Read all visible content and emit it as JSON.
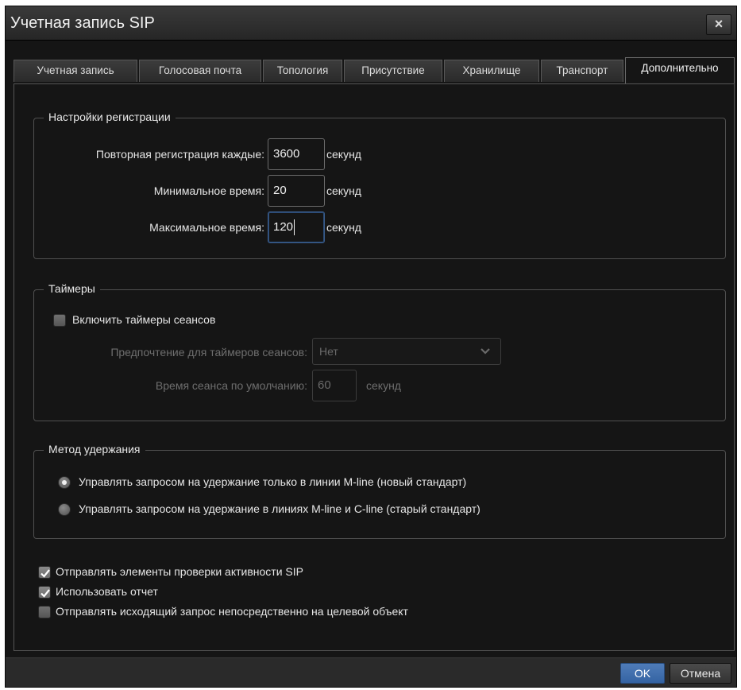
{
  "window": {
    "title": "Учетная запись SIP",
    "close_label": "×"
  },
  "tabs": [
    {
      "label": "Учетная запись"
    },
    {
      "label": "Голосовая почта"
    },
    {
      "label": "Топология"
    },
    {
      "label": "Присутствие"
    },
    {
      "label": "Хранилище"
    },
    {
      "label": "Транспорт"
    },
    {
      "label": "Дополнительно",
      "active": true
    }
  ],
  "registration": {
    "legend": "Настройки регистрации",
    "rows": [
      {
        "label": "Повторная регистрация каждые:",
        "value": "3600",
        "unit": "секунд"
      },
      {
        "label": "Минимальное время:",
        "value": "20",
        "unit": "секунд"
      },
      {
        "label": "Максимальное время:",
        "value": "120",
        "unit": "секунд"
      }
    ]
  },
  "timers": {
    "legend": "Таймеры",
    "enable_label": "Включить таймеры сеансов",
    "enable_checked": false,
    "preference_label": "Предпочтение для таймеров сеансов:",
    "preference_value": "Нет",
    "default_time_label": "Время сеанса по умолчанию:",
    "default_time_value": "60",
    "default_time_unit": "секунд"
  },
  "hold": {
    "legend": "Метод удержания",
    "options": [
      {
        "label": "Управлять запросом на удержание только в линии M-line (новый стандарт)",
        "selected": true
      },
      {
        "label": "Управлять запросом на удержание в линиях M-line и C-line (старый стандарт)",
        "selected": false
      }
    ]
  },
  "options": [
    {
      "label": "Отправлять элементы проверки активности SIP",
      "checked": true
    },
    {
      "label": "Использовать отчет",
      "checked": true
    },
    {
      "label": "Отправлять исходящий запрос непосредственно на целевой объект",
      "checked": false
    }
  ],
  "footer": {
    "ok_label": "OK",
    "cancel_label": "Отмена"
  },
  "colors": {
    "background": "#151515",
    "accent": "#3463a3",
    "border": "#505050"
  }
}
